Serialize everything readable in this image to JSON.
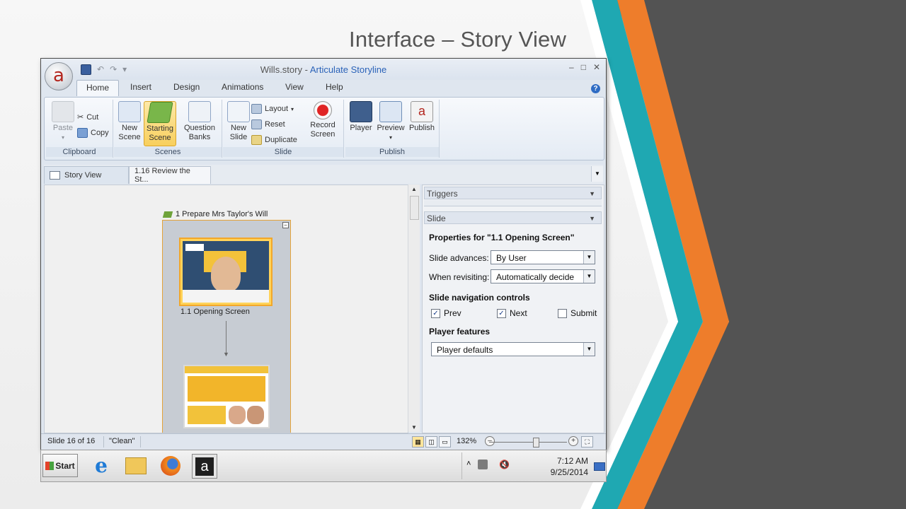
{
  "slide": {
    "title": "Interface – Story View"
  },
  "window": {
    "doc_title": "Wills.story - ",
    "app_title": "Articulate Storyline",
    "logo_letter": "a",
    "controls": [
      "–",
      "□",
      "✕"
    ]
  },
  "ribbon_tabs": [
    "Home",
    "Insert",
    "Design",
    "Animations",
    "View",
    "Help"
  ],
  "ribbon": {
    "clipboard": {
      "label": "Clipboard",
      "paste": "Paste",
      "cut": "Cut",
      "copy": "Copy"
    },
    "scenes": {
      "label": "Scenes",
      "new_scene": [
        "New",
        "Scene"
      ],
      "starting_scene": [
        "Starting",
        "Scene"
      ],
      "question_banks": [
        "Question",
        "Banks"
      ]
    },
    "slide": {
      "label": "Slide",
      "new_slide": [
        "New",
        "Slide"
      ],
      "layout": "Layout",
      "reset": "Reset",
      "duplicate": "Duplicate",
      "record_screen": [
        "Record",
        "Screen"
      ]
    },
    "publish": {
      "label": "Publish",
      "player": "Player",
      "preview": "Preview",
      "publish": "Publish"
    }
  },
  "doc_tabs": [
    "Story View",
    "1.16 Review the St..."
  ],
  "canvas": {
    "scene_title": "1 Prepare Mrs Taylor's Will",
    "slide1_caption": "1.1 Opening Screen"
  },
  "panel": {
    "triggers_header": "Triggers",
    "slide_header": "Slide",
    "properties_title": "Properties for \"1.1 Opening Screen\"",
    "slide_advances_label": "Slide advances:",
    "slide_advances_value": "By User",
    "when_revisiting_label": "When revisiting:",
    "when_revisiting_value": "Automatically decide",
    "nav_controls_header": "Slide navigation controls",
    "nav_controls": [
      {
        "label": "Prev",
        "checked": true
      },
      {
        "label": "Next",
        "checked": true
      },
      {
        "label": "Submit",
        "checked": false
      }
    ],
    "player_features_header": "Player features",
    "player_features_value": "Player defaults"
  },
  "statusbar": {
    "slide_count": "Slide 16 of 16",
    "state": "\"Clean\"",
    "zoom": "132%"
  },
  "taskbar": {
    "start": "Start",
    "time": "7:12 AM",
    "date": "9/25/2014"
  },
  "colors": {
    "accent_orange": "#ee7d2b",
    "accent_teal": "#1fa8b2",
    "dark_gray": "#535353"
  }
}
